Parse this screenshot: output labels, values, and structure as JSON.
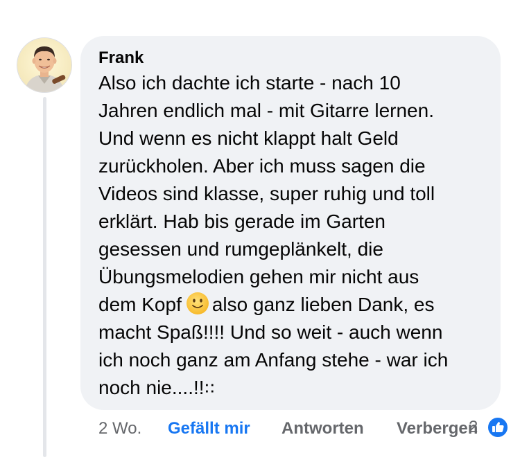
{
  "comment": {
    "author": "Frank",
    "text_lines": [
      "Also ich dachte ich starte - nach 10",
      "Jahren endlich mal - mit Gitarre lernen.",
      "Und wenn es nicht klappt halt Geld",
      "zurückholen. Aber ich muss sagen die",
      "Videos sind klasse, super ruhig und toll",
      "erklärt. Hab bis gerade im Garten",
      "gesessen und rumgeplänkelt, die",
      "Übungsmelodien gehen mir nicht aus",
      "dem Kopf",
      "also ganz lieben Dank, es",
      "macht Spaß!!!! Und so weit - auch wenn",
      "ich noch ganz am Anfang stehe - war ich",
      "noch nie....!!꞉꞉"
    ],
    "emoji_icon": "slightly-smiling-face-icon",
    "avatar_icon": "profile-photo-avatar",
    "time": "2 Wo.",
    "like_label": "Gefällt mir",
    "reply_label": "Antworten",
    "hide_label": "Verbergen",
    "reaction_count": "2",
    "reaction_icon": "like-thumbs-up-icon"
  },
  "colors": {
    "bubble": "#f0f2f5",
    "text": "#050505",
    "muted": "#65676b",
    "accent": "#1877f2"
  }
}
